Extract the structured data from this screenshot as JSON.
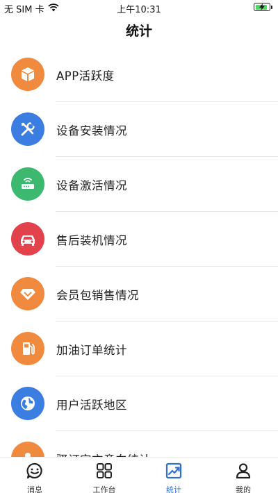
{
  "status_bar": {
    "carrier": "无 SIM 卡",
    "time": "上午10:31"
  },
  "nav": {
    "title": "统计"
  },
  "menu": [
    {
      "label": "APP活跃度",
      "icon": "cube-icon",
      "color": "#F08A3E"
    },
    {
      "label": "设备安装情况",
      "icon": "tools-icon",
      "color": "#3B7DE0"
    },
    {
      "label": "设备激活情况",
      "icon": "router-icon",
      "color": "#3DB870"
    },
    {
      "label": "售后装机情况",
      "icon": "car-icon",
      "color": "#E2424C"
    },
    {
      "label": "会员包销售情况",
      "icon": "diamond-icon",
      "color": "#F08A3E"
    },
    {
      "label": "加油订单统计",
      "icon": "fuel-icon",
      "color": "#F08A3E"
    },
    {
      "label": "用户活跃地区",
      "icon": "globe-icon",
      "color": "#3B7DE0"
    },
    {
      "label": "驿订宝充意向统计",
      "icon": "partial-icon",
      "color": "#F08A3E"
    }
  ],
  "tabs": [
    {
      "label": "消息",
      "icon": "message-icon",
      "active": false
    },
    {
      "label": "工作台",
      "icon": "grid-icon",
      "active": false
    },
    {
      "label": "统计",
      "icon": "chart-icon",
      "active": true
    },
    {
      "label": "我的",
      "icon": "user-icon",
      "active": false
    }
  ],
  "colors": {
    "accent": "#2F6FD6",
    "battery": "#4CD964"
  }
}
